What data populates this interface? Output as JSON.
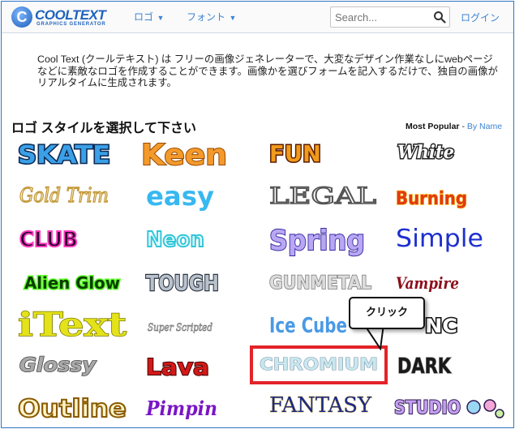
{
  "header": {
    "logo_text": "COOLTEXT",
    "logo_sub": "GRAPHICS GENERATOR",
    "logo_letter": "C",
    "nav_logo": "ロゴ",
    "nav_font": "フォント",
    "search_placeholder": "Search...",
    "login": "ログイン"
  },
  "intro": "Cool Text (クールテキスト) は フリーの画像ジェネレーターで、大変なデザイン作業なしにwebページなどに素敵なロゴを作成することができます。画像かを選びフォームを記入するだけで、独自の画像がリアルタイムに生成されます。",
  "section_title": "ロゴ スタイルを選択して下さい",
  "sort": {
    "active": "Most Popular",
    "separator": "-",
    "by_name": "By Name"
  },
  "callout_text": "クリック",
  "styles": [
    "SKATE",
    "Keen",
    "FUN",
    "White",
    "Gold Trim",
    "easy",
    "LEGAL",
    "Burning",
    "CLUB",
    "Neon",
    "Spring",
    "Simple",
    "Alien Glow",
    "TOUGH",
    "GUNMETAL",
    "Vampire",
    "iText",
    "Super Scripted",
    "Ice Cube",
    "NC",
    "Glossy",
    "Lava",
    "CHROMIUM",
    "DARK",
    "Outline",
    "Pimpin",
    "FANTASY",
    "STUDIO"
  ],
  "colors": {
    "accent": "#3c84d1",
    "highlight": "#e3232a",
    "border": "#2f76c3"
  }
}
